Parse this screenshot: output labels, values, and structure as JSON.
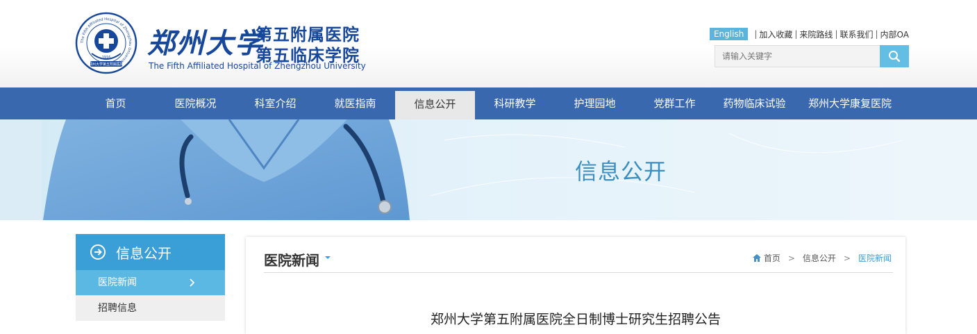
{
  "header": {
    "logo": {
      "emblem_text": "The Fifth Affiliated Hospital of Zhengzhou University",
      "emblem_year": "1916",
      "emblem_bottom": "郑州大学第五附属医院",
      "university": "郑州大学",
      "hospital_line1": "第五附属医院",
      "hospital_line2": "第五临床学院",
      "english_name": "The Fifth Affiliated Hospital of Zhengzhou University"
    },
    "toplinks": {
      "english": "English",
      "items": [
        "加入收藏",
        "来院路线",
        "联系我们",
        "内部OA"
      ],
      "separator": "|"
    },
    "search": {
      "placeholder": "请输入关键字"
    }
  },
  "nav": {
    "items": [
      "首页",
      "医院概况",
      "科室介绍",
      "就医指南",
      "信息公开",
      "科研教学",
      "护理园地",
      "党群工作",
      "药物临床试验",
      "郑州大学康复医院"
    ],
    "active_index": 4
  },
  "banner": {
    "title": "信息公开"
  },
  "sidebar": {
    "title": "信息公开",
    "items": [
      "医院新闻",
      "招聘信息"
    ]
  },
  "content": {
    "section_title": "医院新闻",
    "breadcrumb": {
      "home": "首页",
      "parent": "信息公开",
      "current": "医院新闻",
      "sep": ">"
    },
    "article_title": "郑州大学第五附属医院全日制博士研究生招聘公告"
  },
  "colors": {
    "brand_blue": "#17479b",
    "nav_blue": "#3a68ae",
    "accent": "#3a9fd6",
    "light_accent": "#5ab8e3"
  }
}
